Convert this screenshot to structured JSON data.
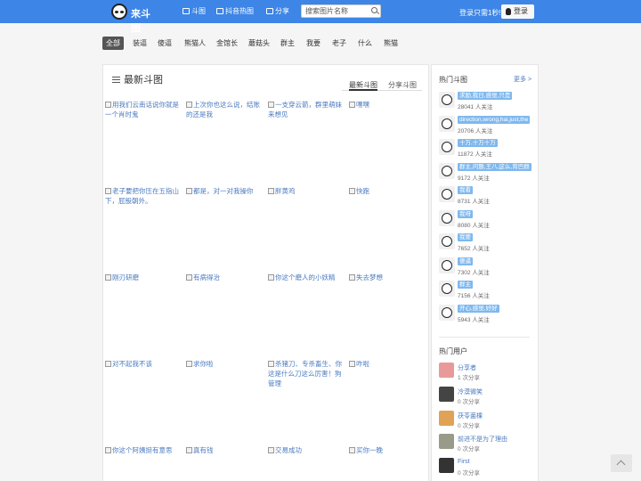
{
  "header": {
    "logo_text": "来斗图",
    "nav": [
      "斗图",
      "抖音热图",
      "分享"
    ],
    "search_placeholder": "搜索图片名称",
    "login_hint": "登录只需1秒!",
    "login_label": "登录"
  },
  "tags": [
    "全部",
    "装逼",
    "傻逼",
    "熊猫人",
    "金馆长",
    "蘑菇头",
    "群主",
    "我要",
    "老子",
    "什么",
    "熊猫"
  ],
  "main": {
    "title": "最新斗图",
    "tabs": [
      "最新斗图",
      "分享斗图"
    ],
    "images": [
      "用我们云南话说你就是一个肖时鬼",
      "上次你也这么说，结账的还是我",
      "一支穿云箭，群里萌妹来想见",
      "嘿嘿",
      "老子要把你压在五指山下，屁股朝外。",
      "都是，对一对我操你",
      "胖黄鸡",
      "快跑",
      "刚刃研磨",
      "有病得治",
      "你这个磨人的小妖精",
      "失去梦想",
      "对不起我不该",
      "求你啦",
      "杀猪刀、专杀畜生、你这是什么刀这么厉害！狗管理",
      "咋啦",
      "你这个阿姨挺有意思",
      "真有钱",
      "交易成功",
      "买你一晚"
    ]
  },
  "sidebar": {
    "hot_title": "热门斗图",
    "more": "更多 >",
    "hot": [
      {
        "tag": "求励,我日,感觉,只是",
        "count": "28041",
        "unit": "人关注"
      },
      {
        "tag": "direction,wrong,hai,just,the",
        "count": "20706",
        "unit": "人关注"
      },
      {
        "tag": "十万,十万十万",
        "count": "11872",
        "unit": "人关注"
      },
      {
        "tag": "群主,问题,王八,这么,背巴群",
        "count": "9172",
        "unit": "人关注"
      },
      {
        "tag": "我看",
        "count": "8731",
        "unit": "人关注"
      },
      {
        "tag": "我呀",
        "count": "8080",
        "unit": "人关注"
      },
      {
        "tag": "我要",
        "count": "7652",
        "unit": "人关注"
      },
      {
        "tag": "傻逼",
        "count": "7302",
        "unit": "人关注"
      },
      {
        "tag": "群主",
        "count": "7156",
        "unit": "人关注"
      },
      {
        "tag": "开心,感觉,好好",
        "count": "5943",
        "unit": "人关注"
      }
    ],
    "users_title": "热门用户",
    "users": [
      {
        "name": "分享者",
        "count": "1",
        "unit": "次分享"
      },
      {
        "name": "冷漠微笑",
        "count": "0",
        "unit": "次分享"
      },
      {
        "name": "茯苓菌棵",
        "count": "0",
        "unit": "次分享"
      },
      {
        "name": "前进不是为了理由",
        "count": "0",
        "unit": "次分享"
      },
      {
        "name": "First",
        "count": "0",
        "unit": "次分享"
      }
    ]
  },
  "colors": {
    "primary": "#3d85e6",
    "tag_bg": "#7fb8ee",
    "link": "#4a7abf"
  }
}
